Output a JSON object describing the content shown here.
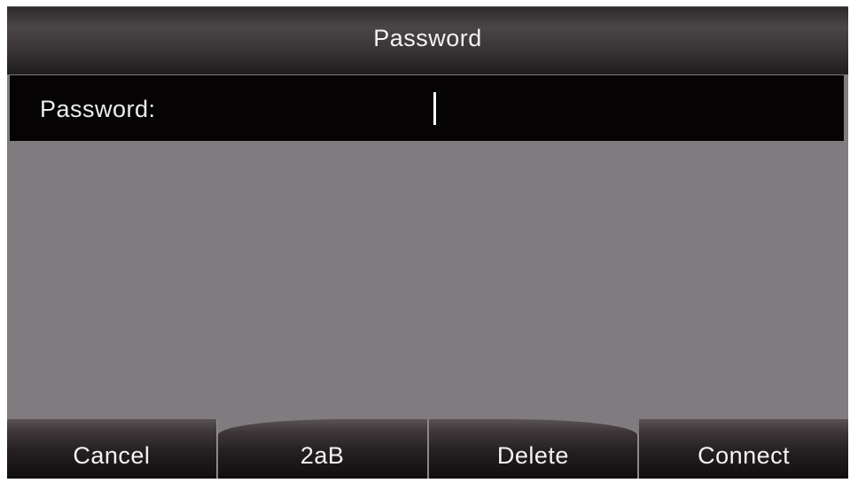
{
  "header": {
    "title": "Password"
  },
  "field": {
    "label": "Password:",
    "value": ""
  },
  "softkeys": [
    {
      "label": "Cancel"
    },
    {
      "label": "2aB"
    },
    {
      "label": "Delete"
    },
    {
      "label": "Connect"
    }
  ],
  "colors": {
    "background": "#807b7e",
    "title_bar": "#3b3638",
    "field_row": "#060304",
    "text": "#f2f2f2"
  }
}
